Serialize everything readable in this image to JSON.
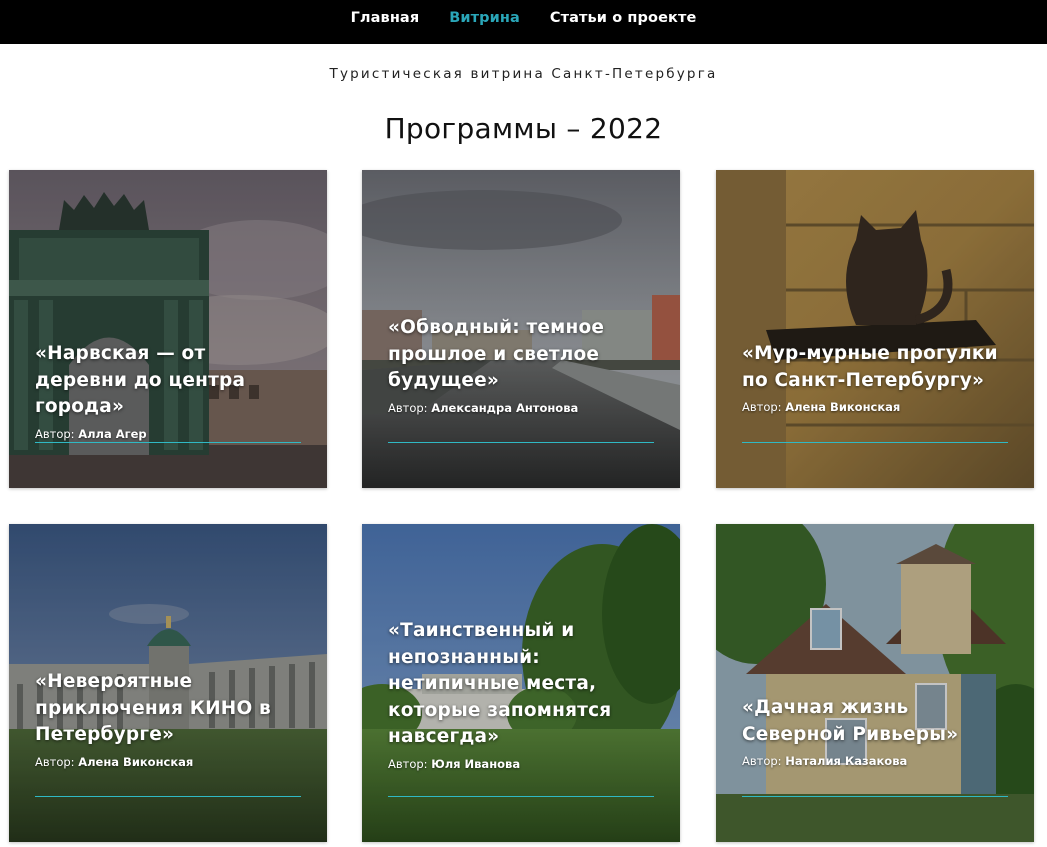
{
  "nav": {
    "items": [
      {
        "label": "Главная"
      },
      {
        "label": "Витрина"
      },
      {
        "label": "Статьи о проекте"
      }
    ],
    "active_index": 1
  },
  "header": {
    "subtitle": "Туристическая витрина Санкт-Петербурга",
    "title": "Программы – 2022"
  },
  "cards": [
    {
      "title": "«Нарвская — от деревни до центра города»",
      "author_prefix": "Автор:",
      "author": "Алла Агер",
      "image": "narva-triumphal-arch-photo"
    },
    {
      "title": "«Обводный: темное прошлое и светлое будущее»",
      "author_prefix": "Автор:",
      "author": "Александра Антонова",
      "image": "obvodny-canal-photo"
    },
    {
      "title": "«Мур-мурные прогулки по Санкт-Петербургу»",
      "author_prefix": "Автор:",
      "author": "Алена Виконская",
      "image": "cat-statue-photo"
    },
    {
      "title": "«Невероятные приключения КИНО в Петербурге»",
      "author_prefix": "Автор:",
      "author": "Алена Виконская",
      "image": "kazan-cathedral-photo"
    },
    {
      "title": "«Таинственный и непознанный: нетипичные места, которые запомнятся навсегда»",
      "author_prefix": "Автор:",
      "author": "Юля Иванова",
      "image": "park-trees-photo"
    },
    {
      "title": "«Дачная жизнь Северной Ривьеры»",
      "author_prefix": "Автор:",
      "author": "Наталия Казакова",
      "image": "dacha-house-photo"
    }
  ],
  "colors": {
    "nav_bg": "#000000",
    "nav_active": "#2aa6b8",
    "accent_rule": "#2fb9c4"
  }
}
